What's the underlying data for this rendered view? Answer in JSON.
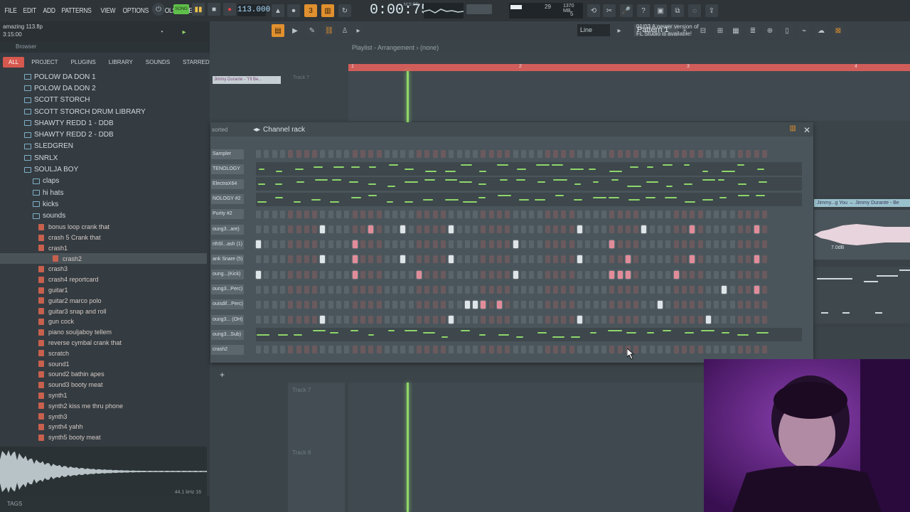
{
  "menu": [
    "FILE",
    "EDIT",
    "ADD",
    "PATTERNS",
    "VIEW",
    "OPTIONS",
    "TOOLS",
    "HELP"
  ],
  "hint": {
    "project": "amazing 113.flp",
    "time": "3:15:00"
  },
  "transport": {
    "mode": "SONG",
    "tempo": "113.000",
    "time": "0:00:75",
    "time_unit": "M:S:CS"
  },
  "cpu": {
    "voices": "29",
    "memory": "1370 MB",
    "count": "5"
  },
  "toolbar": {
    "snap": "Line",
    "pattern": "Pattern 1"
  },
  "news": {
    "date": "01/03",
    "line1": "A newer version of",
    "line2": "FL Studio is available!"
  },
  "browser": {
    "header": "Browser",
    "tabs": [
      "ALL",
      "PROJECT",
      "PLUGINS",
      "LIBRARY",
      "SOUNDS",
      "STARRED"
    ],
    "folders": [
      {
        "label": "POLOW DA DON 1",
        "level": 0
      },
      {
        "label": "POLOW DA DON 2",
        "level": 0
      },
      {
        "label": "SCOTT STORCH",
        "level": 0
      },
      {
        "label": "SCOTT STORCH DRUM LIBRARY",
        "level": 0
      },
      {
        "label": "SHAWTY REDD 1 - DDB",
        "level": 0
      },
      {
        "label": "SHAWTY REDD 2 - DDB",
        "level": 0
      },
      {
        "label": "SLEDGREN",
        "level": 0
      },
      {
        "label": "SNRLX",
        "level": 0
      },
      {
        "label": "SOULJA BOY",
        "level": 0,
        "open": true
      },
      {
        "label": "claps",
        "level": 1
      },
      {
        "label": "hi hats",
        "level": 1
      },
      {
        "label": "kicks",
        "level": 1
      },
      {
        "label": "sounds",
        "level": 1,
        "open": true
      }
    ],
    "files": [
      "bonus loop crank that",
      "crash 5 Crank that",
      "crash1",
      "crash2",
      "crash3",
      "crash4 reportcard",
      "guitar1",
      "guitar2 marco polo",
      "guitar3 snap and roll",
      "gun cock",
      "piano souljaboy tellem",
      "reverse cymbal crank that",
      "scratch",
      "sound1",
      "sound2 bathin apes",
      "sound3 booty meat",
      "synth1",
      "synth2 kiss me thru phone",
      "synth3",
      "synth4 yahh",
      "synth5 booty meat"
    ],
    "selected_file": "crash2",
    "preview_info": "44.1 kHz 16",
    "tags": "TAGS"
  },
  "playlist": {
    "title": "Playlist - Arrangement",
    "pattern": "(none)",
    "bars": [
      "1",
      "2",
      "3",
      "4"
    ],
    "clip_top": "Jimmy Durante - \"I'll Be...",
    "track_labels": [
      "Track 7",
      "Track 7",
      "Track 8"
    ],
    "right_clip": "Jimmy...g You ↔ Jimmy Durante - Be",
    "right_db": "7.0dB"
  },
  "channel_rack": {
    "sort_label": "sorted",
    "title": "Channel rack",
    "channels": [
      {
        "name": "Sampler",
        "type": "steps",
        "lit": []
      },
      {
        "name": "TENOLOGY",
        "type": "roll"
      },
      {
        "name": "ElectraX64",
        "type": "roll"
      },
      {
        "name": "NOLOGY #2",
        "type": "roll"
      },
      {
        "name": "Purity #2",
        "type": "steps",
        "lit": []
      },
      {
        "name": "oung3...are)",
        "type": "steps",
        "lit": [
          8,
          14,
          18,
          24,
          40,
          48,
          54,
          62
        ]
      },
      {
        "name": "rthSl...ash (1)",
        "type": "steps",
        "lit": [
          0,
          12,
          32,
          44
        ]
      },
      {
        "name": "ank Snare (5)",
        "type": "steps",
        "lit": [
          8,
          12,
          18,
          24,
          40,
          46,
          54,
          62
        ]
      },
      {
        "name": "oung...(Kick)",
        "type": "steps",
        "lit": [
          0,
          12,
          20,
          32,
          44,
          45,
          46,
          52
        ]
      },
      {
        "name": "oung3...Perc)",
        "type": "steps",
        "lit": [
          58,
          62
        ]
      },
      {
        "name": "ouisdif...Perc)",
        "type": "steps",
        "lit": [
          26,
          27,
          28,
          30,
          50
        ]
      },
      {
        "name": "oung3... (OH)",
        "type": "steps",
        "lit": [
          8,
          24,
          40,
          56
        ]
      },
      {
        "name": "oung3...Sub)",
        "type": "roll"
      },
      {
        "name": "crash2",
        "type": "steps",
        "lit": []
      }
    ]
  }
}
